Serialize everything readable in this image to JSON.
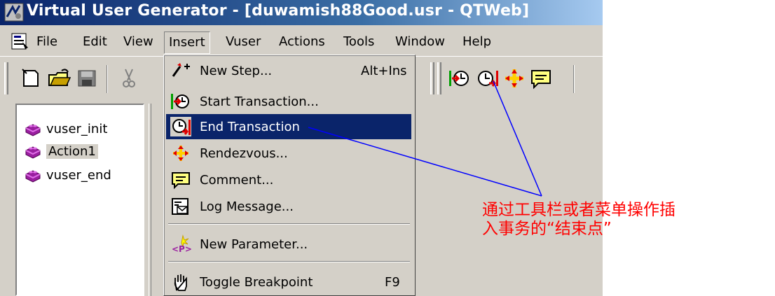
{
  "window": {
    "title": "Virtual User Generator - [duwamish88Good.usr - QTWeb]"
  },
  "menubar": {
    "items": [
      {
        "label": "File",
        "underline": "F"
      },
      {
        "label": "Edit"
      },
      {
        "label": "View"
      },
      {
        "label": "Insert",
        "active": true
      },
      {
        "label": "Vuser"
      },
      {
        "label": "Actions"
      },
      {
        "label": "Tools"
      },
      {
        "label": "Window"
      },
      {
        "label": "Help"
      }
    ]
  },
  "toolbar": {
    "buttons": [
      {
        "icon": "new-document-icon"
      },
      {
        "icon": "open-folder-icon"
      },
      {
        "icon": "save-disk-icon"
      },
      {
        "icon": "cut-scissors-icon"
      },
      {
        "icon": "start-transaction-icon"
      },
      {
        "icon": "end-transaction-icon"
      },
      {
        "icon": "rendezvous-icon"
      },
      {
        "icon": "comment-icon"
      }
    ]
  },
  "tree": {
    "items": [
      {
        "label": "vuser_init",
        "icon": "action-block-icon"
      },
      {
        "label": "Action1",
        "icon": "action-block-icon",
        "selected": true
      },
      {
        "label": "vuser_end",
        "icon": "action-block-icon"
      }
    ]
  },
  "insert_menu": {
    "items": [
      {
        "label": "New Step...",
        "shortcut": "Alt+Ins",
        "icon": "new-step-icon"
      },
      {
        "label": "Start Transaction...",
        "shortcut": "",
        "icon": "start-transaction-icon"
      },
      {
        "label": "End Transaction",
        "shortcut": "",
        "icon": "end-transaction-icon",
        "highlighted": true
      },
      {
        "label": "Rendezvous...",
        "shortcut": "",
        "icon": "rendezvous-icon"
      },
      {
        "label": "Comment...",
        "shortcut": "",
        "icon": "comment-icon"
      },
      {
        "label": "Log Message...",
        "shortcut": "",
        "icon": "log-message-icon"
      },
      {
        "label": "New Parameter...",
        "shortcut": "",
        "icon": "parameter-icon"
      },
      {
        "label": "Toggle Breakpoint",
        "shortcut": "F9",
        "icon": "breakpoint-hand-icon"
      }
    ]
  },
  "annotation": {
    "line1": "通过工具栏或者菜单操作插",
    "line2": "入事务的“结束点”",
    "color": "#ff0000",
    "line_color": "#0000ff"
  },
  "colors": {
    "face": "#d4d0c8",
    "highlight": "#0a246a",
    "title_start": "#0a246a",
    "title_end": "#a6caf0"
  }
}
